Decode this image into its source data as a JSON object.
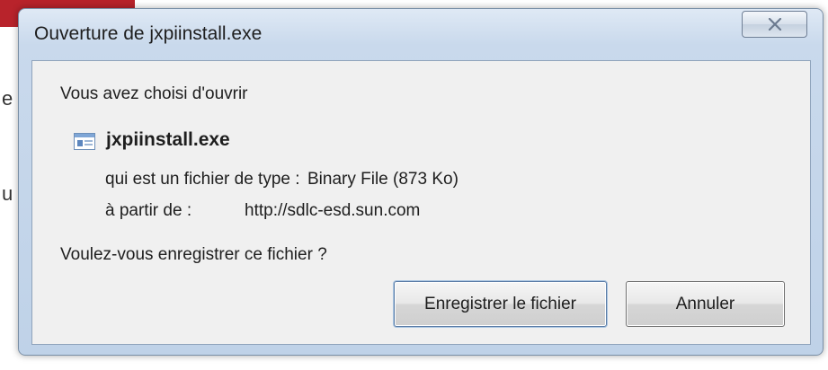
{
  "background": {
    "fragment_top": "e",
    "fragment_bottom": "u"
  },
  "dialog": {
    "title": "Ouverture de jxpiinstall.exe",
    "intro": "Vous avez choisi d'ouvrir",
    "file_icon": "executable-file-icon",
    "filename": "jxpiinstall.exe",
    "type_label": "qui est un fichier de type :",
    "type_value": "Binary File (873 Ko)",
    "from_label": "à partir de :",
    "from_value": "http://sdlc-esd.sun.com",
    "question": "Voulez-vous enregistrer ce fichier ?",
    "buttons": {
      "save": "Enregistrer le fichier",
      "cancel": "Annuler"
    }
  },
  "colors": {
    "frame": "#c9d9ec",
    "panel": "#f0f0f0",
    "background_accent": "#b8232b"
  }
}
